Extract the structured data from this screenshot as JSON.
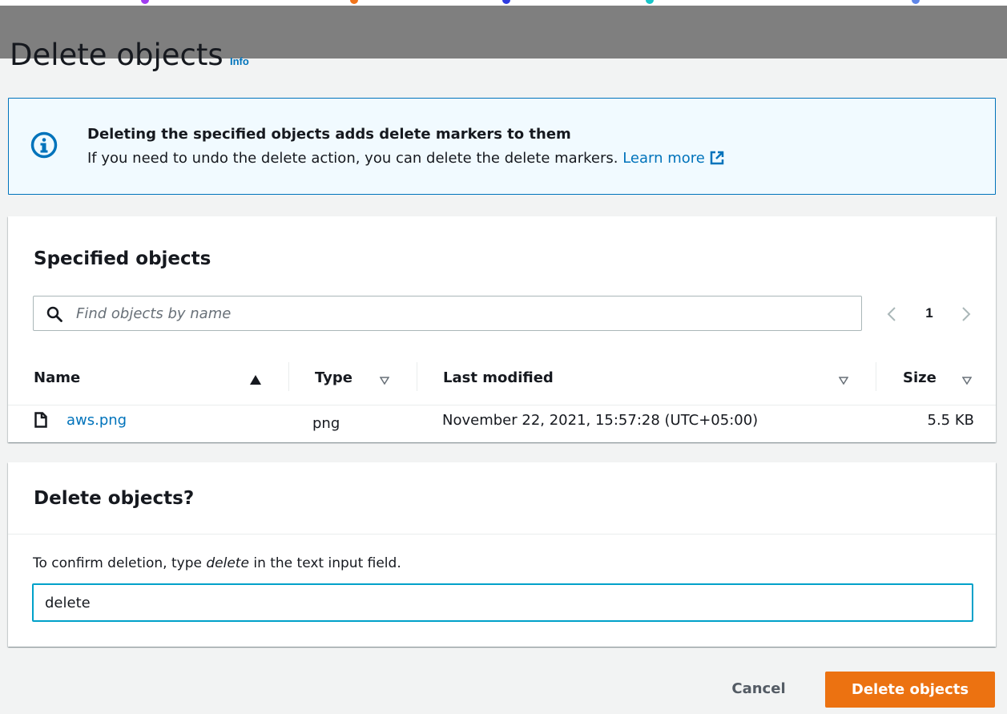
{
  "page": {
    "title": "Delete objects",
    "info_link": "Info"
  },
  "alert": {
    "title": "Deleting the specified objects adds delete markers to them",
    "message": "If you need to undo the delete action, you can delete the delete markers.",
    "link": "Learn more",
    "icon": "info-circle-icon",
    "accent_color": "#0073bb"
  },
  "specified_objects": {
    "title": "Specified objects",
    "search_placeholder": "Find objects by name",
    "pagination": {
      "current_page": "1"
    },
    "columns": [
      {
        "label": "Name",
        "sort": "ascending"
      },
      {
        "label": "Type",
        "sort": "none"
      },
      {
        "label": "Last modified",
        "sort": "none"
      },
      {
        "label": "Size",
        "sort": "none"
      }
    ],
    "rows": [
      {
        "name": "aws.png",
        "type": "png",
        "last_modified": "November 22, 2021, 15:57:28 (UTC+05:00)",
        "size": "5.5 KB"
      }
    ]
  },
  "confirm": {
    "title": "Delete objects?",
    "instruction_before": "To confirm deletion, type ",
    "instruction_keyword": "delete",
    "instruction_after": " in the text input field.",
    "input_value": "delete"
  },
  "actions": {
    "cancel_label": "Cancel",
    "delete_label": "Delete objects",
    "primary_color": "#ec7211"
  }
}
